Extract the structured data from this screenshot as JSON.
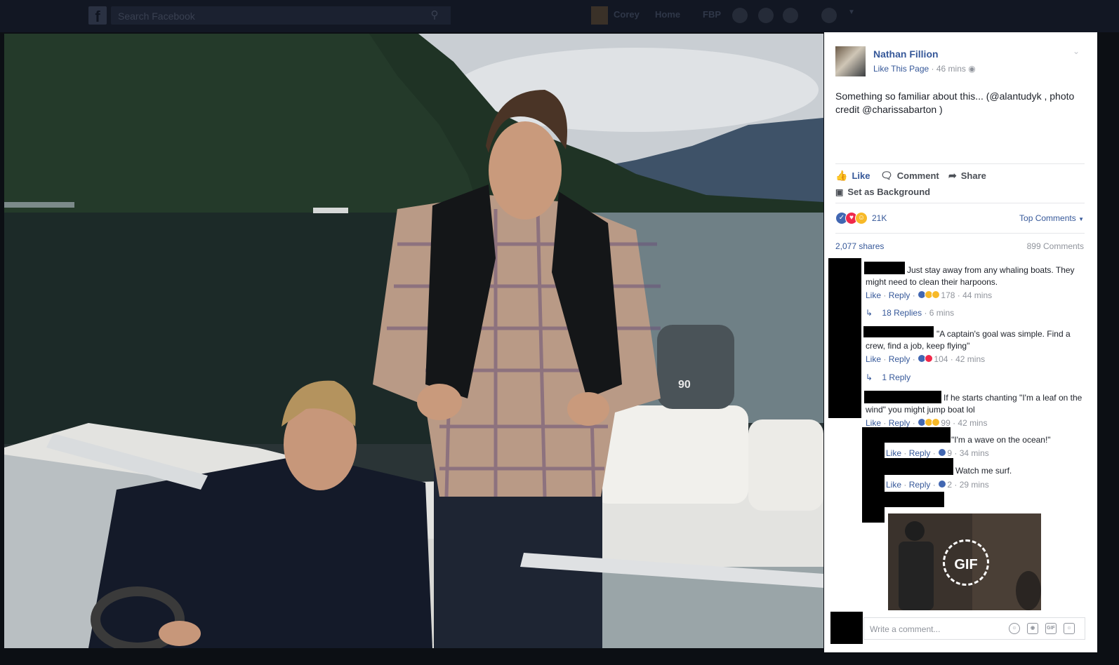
{
  "topbar": {
    "search_placeholder": "Search Facebook",
    "nav": {
      "profile_name": "Corey",
      "home": "Home",
      "fbp": "FBP"
    },
    "icons": [
      "facebook-logo-icon",
      "search-icon",
      "friends-icon",
      "messages-icon",
      "globe-icon",
      "help-icon",
      "chevron-down-icon"
    ]
  },
  "post": {
    "page_name": "Nathan Fillion",
    "like_page": "Like This Page",
    "time": "46 mins",
    "privacy_icon": "globe-icon",
    "text": "Something so familiar about this... (@alantudyk , photo credit @charissabarton )"
  },
  "actions": {
    "like": "Like",
    "comment": "Comment",
    "share": "Share",
    "set_background": "Set as Background"
  },
  "stats": {
    "reaction_count": "21K",
    "reaction_icons": [
      "like",
      "love",
      "haha"
    ],
    "top_comments": "Top Comments",
    "shares": "2,077 shares",
    "comments": "899 Comments"
  },
  "comments": [
    {
      "text": "Just stay away from any whaling boats. They might need to clean their harpoons.",
      "like": "Like",
      "reply": "Reply",
      "reactions": "178",
      "time": "44 mins",
      "replies_label": "18 Replies",
      "replies_time": "6 mins"
    },
    {
      "text": "\"A captain's goal was simple. Find a crew, find a job, keep flying\"",
      "like": "Like",
      "reply": "Reply",
      "reactions": "104",
      "time": "42 mins",
      "replies_label": "1 Reply"
    },
    {
      "text": "If he starts chanting \"I'm a leaf on the wind\" you might jump boat lol",
      "like": "Like",
      "reply": "Reply",
      "reactions": "99",
      "time": "42 mins"
    }
  ],
  "replies": [
    {
      "text": "\"I'm a wave on the ocean!\"",
      "like": "Like",
      "reply": "Reply",
      "reactions": "9",
      "time": "34 mins"
    },
    {
      "text": "Watch me surf.",
      "like": "Like",
      "reply": "Reply",
      "reactions": "2",
      "time": "29 mins"
    }
  ],
  "gif": {
    "label": "GIF"
  },
  "composer": {
    "placeholder": "Write a comment...",
    "icons": [
      "emoji-icon",
      "camera-icon",
      "gif-icon",
      "sticker-icon"
    ]
  },
  "colors": {
    "link": "#365899",
    "meta": "#90949c",
    "text": "#1d2129",
    "topbar": "#121723"
  }
}
